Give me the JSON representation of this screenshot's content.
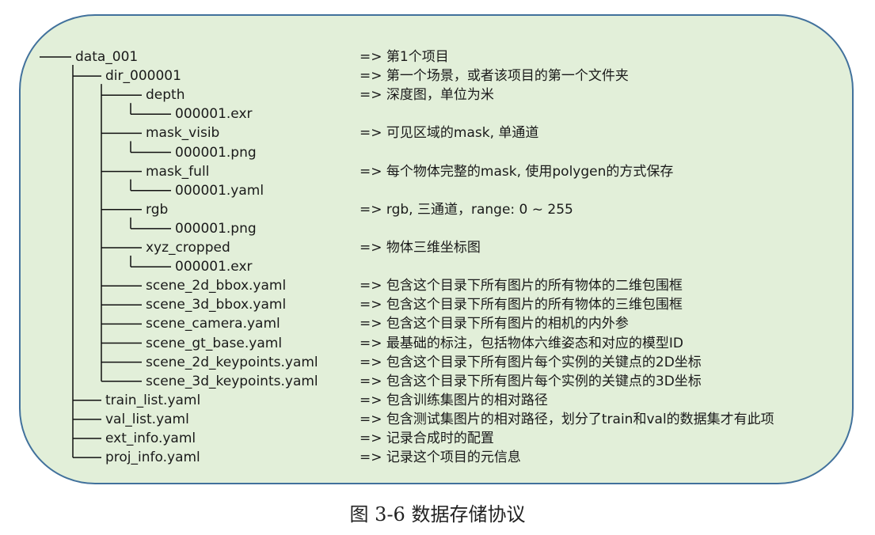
{
  "caption": "图 3-6  数据存储协议",
  "entries": [
    {
      "depth": 0,
      "label": "data_001",
      "desc": "=> 第1个项目"
    },
    {
      "depth": 1,
      "label": "dir_000001",
      "desc": "=> 第一个场景，或者该项目的第一个文件夹"
    },
    {
      "depth": 2,
      "label": "depth",
      "desc": "=> 深度图，单位为米"
    },
    {
      "depth": 3,
      "label": "000001.exr",
      "desc": ""
    },
    {
      "depth": 2,
      "label": "mask_visib",
      "desc": "=> 可见区域的mask, 单通道"
    },
    {
      "depth": 3,
      "label": "000001.png",
      "desc": ""
    },
    {
      "depth": 2,
      "label": "mask_full",
      "desc": "=> 每个物体完整的mask, 使用polygen的方式保存"
    },
    {
      "depth": 3,
      "label": "000001.yaml",
      "desc": ""
    },
    {
      "depth": 2,
      "label": "rgb",
      "desc": "=> rgb, 三通道，range: 0 ~ 255"
    },
    {
      "depth": 3,
      "label": "000001.png",
      "desc": ""
    },
    {
      "depth": 2,
      "label": "xyz_cropped",
      "desc": "=> 物体三维坐标图"
    },
    {
      "depth": 3,
      "label": "000001.exr",
      "desc": ""
    },
    {
      "depth": 2,
      "label": "scene_2d_bbox.yaml",
      "desc": "=> 包含这个目录下所有图片的所有物体的二维包围框"
    },
    {
      "depth": 2,
      "label": "scene_3d_bbox.yaml",
      "desc": "=> 包含这个目录下所有图片的所有物体的三维包围框"
    },
    {
      "depth": 2,
      "label": "scene_camera.yaml",
      "desc": "=> 包含这个目录下所有图片的相机的内外参"
    },
    {
      "depth": 2,
      "label": "scene_gt_base.yaml",
      "desc": "=> 最基础的标注，包括物体六维姿态和对应的模型ID"
    },
    {
      "depth": 2,
      "label": "scene_2d_keypoints.yaml",
      "desc": "=> 包含这个目录下所有图片每个实例的关键点的2D坐标"
    },
    {
      "depth": 2,
      "label": "scene_3d_keypoints.yaml",
      "desc": "=> 包含这个目录下所有图片每个实例的关键点的3D坐标"
    },
    {
      "depth": 1,
      "label": "train_list.yaml",
      "desc": "=> 包含训练集图片的相对路径"
    },
    {
      "depth": 1,
      "label": "val_list.yaml",
      "desc": "=> 包含测试集图片的相对路径，划分了train和val的数据集才有此项"
    },
    {
      "depth": 1,
      "label": "ext_info.yaml",
      "desc": "=> 记录合成时的配置"
    },
    {
      "depth": 1,
      "label": "proj_info.yaml",
      "desc": "=> 记录这个项目的元信息"
    }
  ]
}
